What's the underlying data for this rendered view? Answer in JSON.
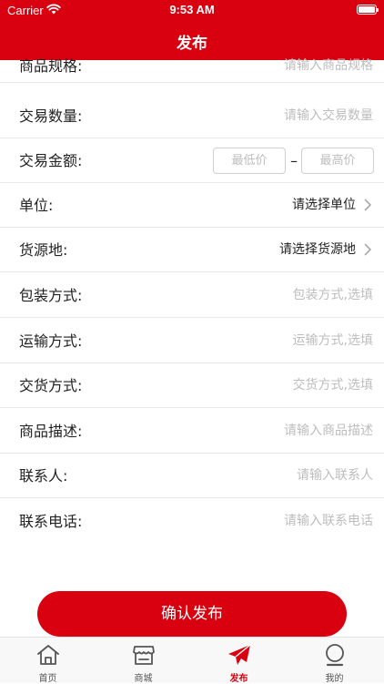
{
  "status": {
    "carrier": "Carrier",
    "time": "9:53 AM"
  },
  "nav": {
    "title": "发布"
  },
  "form": {
    "spec": {
      "label": "商品规格:",
      "placeholder": "请输入商品规格"
    },
    "quantity": {
      "label": "交易数量:",
      "placeholder": "请输入交易数量"
    },
    "amount": {
      "label": "交易金额:",
      "min_placeholder": "最低价",
      "max_placeholder": "最高价",
      "dash": "–"
    },
    "unit": {
      "label": "单位:",
      "value": "请选择单位"
    },
    "origin": {
      "label": "货源地:",
      "value": "请选择货源地"
    },
    "packaging": {
      "label": "包装方式:",
      "placeholder": "包装方式,选填"
    },
    "transport": {
      "label": "运输方式:",
      "placeholder": "运输方式,选填"
    },
    "delivery": {
      "label": "交货方式:",
      "placeholder": "交货方式,选填"
    },
    "description": {
      "label": "商品描述:",
      "placeholder": "请输入商品描述"
    },
    "contact": {
      "label": "联系人:",
      "placeholder": "请输入联系人"
    },
    "phone": {
      "label": "联系电话:",
      "placeholder": "请输入联系电话"
    }
  },
  "confirm_label": "确认发布",
  "tabs": [
    {
      "label": "首页",
      "icon": "home-icon"
    },
    {
      "label": "商城",
      "icon": "shop-icon"
    },
    {
      "label": "发布",
      "icon": "paper-plane-icon"
    },
    {
      "label": "我的",
      "icon": "user-icon"
    }
  ],
  "colors": {
    "brand": "#d9000f",
    "placeholder": "#bdbdbd"
  }
}
